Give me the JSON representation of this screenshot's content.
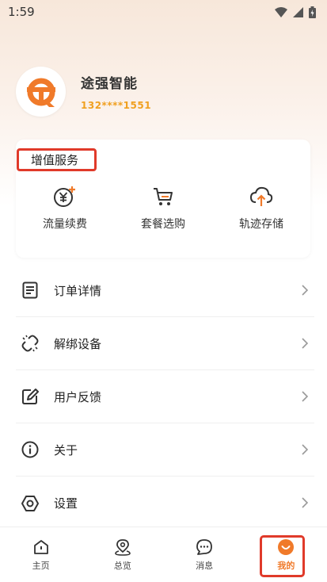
{
  "status_bar": {
    "time": "1:59"
  },
  "profile": {
    "name": "途强智能",
    "phone": "132****1551"
  },
  "services": {
    "title": "增值服务",
    "items": [
      {
        "label": "流量续费",
        "icon": "traffic-recharge-icon"
      },
      {
        "label": "套餐选购",
        "icon": "shopping-cart-icon"
      },
      {
        "label": "轨迹存储",
        "icon": "cloud-upload-icon"
      }
    ]
  },
  "menu": [
    {
      "label": "订单详情",
      "icon": "order-icon"
    },
    {
      "label": "解绑设备",
      "icon": "unlink-icon"
    },
    {
      "label": "用户反馈",
      "icon": "feedback-icon"
    },
    {
      "label": "关于",
      "icon": "info-icon"
    },
    {
      "label": "设置",
      "icon": "settings-icon"
    }
  ],
  "bottom_nav": [
    {
      "label": "主页",
      "icon": "home-icon"
    },
    {
      "label": "总览",
      "icon": "map-pin-icon"
    },
    {
      "label": "消息",
      "icon": "message-icon"
    },
    {
      "label": "我的",
      "icon": "profile-icon",
      "active": true
    }
  ],
  "colors": {
    "accent": "#f07a2a",
    "phone": "#f0a020",
    "highlight_box": "#e03a2a"
  }
}
